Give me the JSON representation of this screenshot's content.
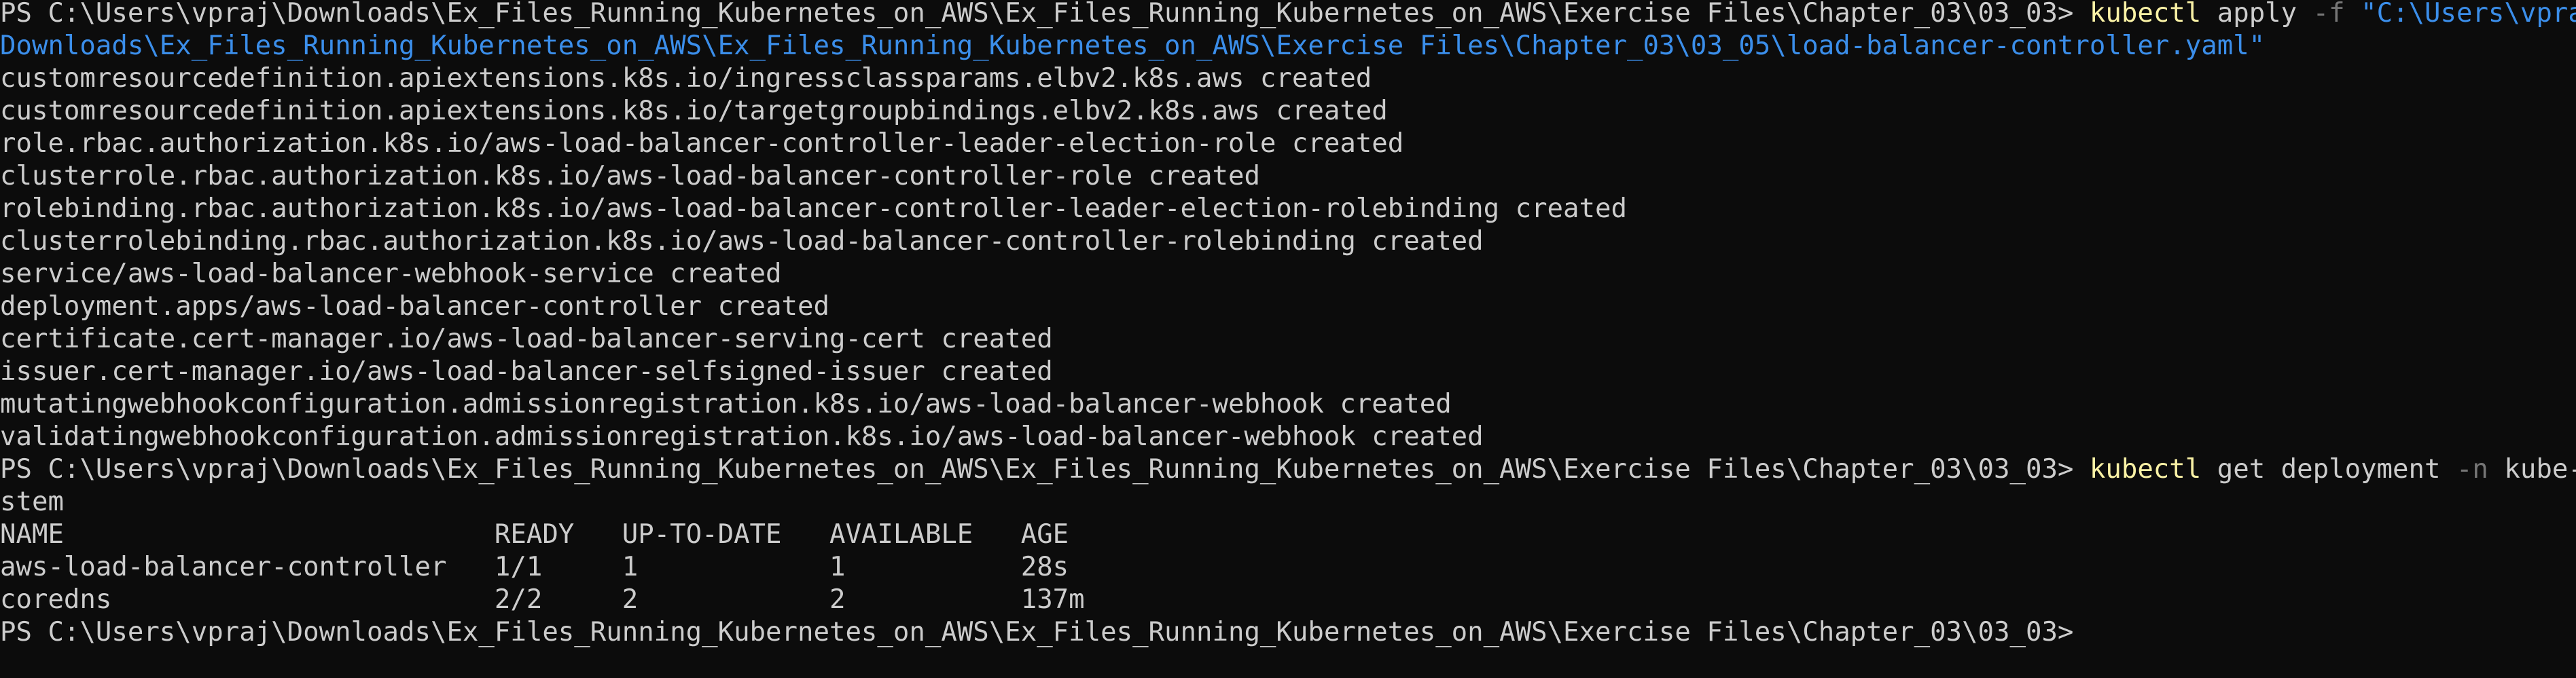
{
  "terminal": {
    "prompt": "PS C:\\Users\\vpraj\\Downloads\\Ex_Files_Running_Kubernetes_on_AWS\\Ex_Files_Running_Kubernetes_on_AWS\\Exercise Files\\Chapter_03\\03_03> ",
    "colors": {
      "background": "#0c0c0c",
      "text": "#cccccc",
      "command": "#f9f1a5",
      "flag": "#767676",
      "string": "#3b8eea"
    },
    "command1": {
      "cmd": "kubectl",
      "args": " apply ",
      "flag": "-f",
      "path_part1": " \"C:\\Users\\vpraj\\",
      "path_part2": "Downloads\\Ex_Files_Running_Kubernetes_on_AWS\\Ex_Files_Running_Kubernetes_on_AWS\\Exercise Files\\Chapter_03\\03_05\\load-balancer-controller.yaml\""
    },
    "apply_output": [
      "customresourcedefinition.apiextensions.k8s.io/ingressclassparams.elbv2.k8s.aws created",
      "customresourcedefinition.apiextensions.k8s.io/targetgroupbindings.elbv2.k8s.aws created",
      "role.rbac.authorization.k8s.io/aws-load-balancer-controller-leader-election-role created",
      "clusterrole.rbac.authorization.k8s.io/aws-load-balancer-controller-role created",
      "rolebinding.rbac.authorization.k8s.io/aws-load-balancer-controller-leader-election-rolebinding created",
      "clusterrolebinding.rbac.authorization.k8s.io/aws-load-balancer-controller-rolebinding created",
      "service/aws-load-balancer-webhook-service created",
      "deployment.apps/aws-load-balancer-controller created",
      "certificate.cert-manager.io/aws-load-balancer-serving-cert created",
      "issuer.cert-manager.io/aws-load-balancer-selfsigned-issuer created",
      "mutatingwebhookconfiguration.admissionregistration.k8s.io/aws-load-balancer-webhook created",
      "validatingwebhookconfiguration.admissionregistration.k8s.io/aws-load-balancer-webhook created"
    ],
    "command2": {
      "cmd": "kubectl",
      "args": " get deployment ",
      "flag": "-n",
      "ns_part1": " kube-sy",
      "ns_part2": "stem"
    },
    "table_header": "NAME                           READY   UP-TO-DATE   AVAILABLE   AGE",
    "table_rows": [
      "aws-load-balancer-controller   1/1     1            1           28s",
      "coredns                        2/2     2            2           137m"
    ]
  }
}
